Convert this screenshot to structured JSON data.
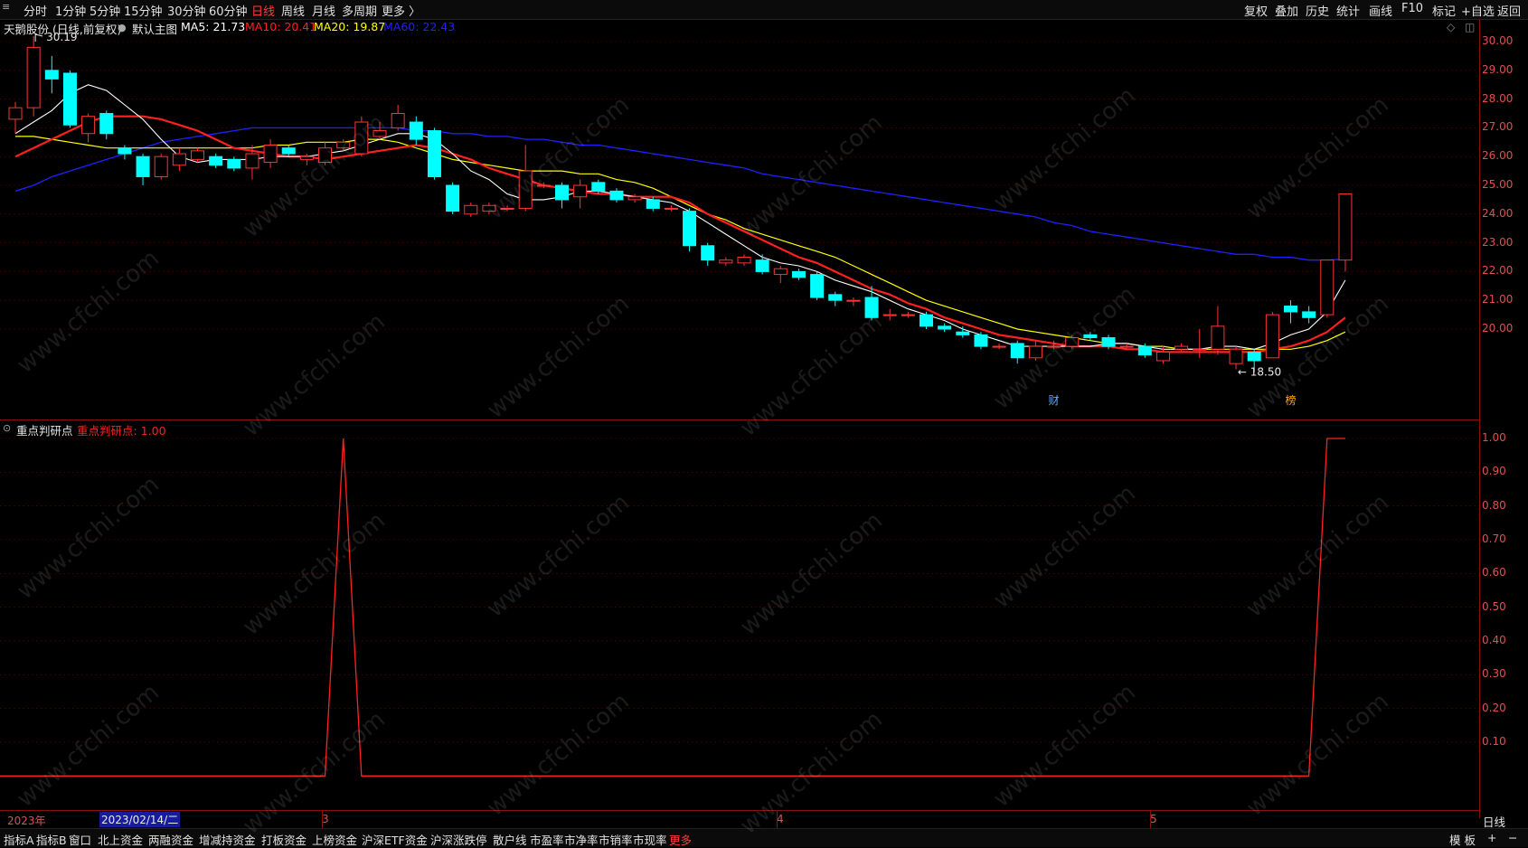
{
  "toolbar": {
    "left": [
      "分时",
      "1分钟",
      "5分钟",
      "15分钟",
      "30分钟",
      "60分钟",
      "日线",
      "周线",
      "月线",
      "多周期",
      "更多 〉"
    ],
    "active": "日线",
    "right": [
      "复权",
      "叠加",
      "历史",
      "统计",
      "画线",
      "F10",
      "标记",
      "+自选",
      "返回"
    ]
  },
  "main_info": {
    "stock": "天鹅股份 (日线,前复权)",
    "template": "默认主图",
    "ma5": "MA5: 21.73",
    "ma10": "MA10: 20.41",
    "ma20": "MA20: 19.87",
    "ma60": "MA60: 22.43",
    "high_label": "30.19",
    "low_label": "18.50",
    "marker_cai": "财",
    "marker_bang": "榜"
  },
  "sub_info": {
    "name": "重点判研点",
    "value": "重点判研点: 1.00"
  },
  "x_axis": {
    "year_label": "2023年",
    "cursor_date": "2023/02/14/二",
    "month_labels": [
      "3",
      "4",
      "5"
    ],
    "right_label": "日线"
  },
  "bottom_tabs": [
    "指标A",
    "指标B",
    "窗口",
    "北上资金",
    "两融资金",
    "增减持资金",
    "打板资金",
    "上榜资金",
    "沪深ETF资金",
    "沪深涨跌停",
    "散户线",
    "市盈率",
    "市净率",
    "市销率",
    "市现率",
    "更多"
  ],
  "bottom_active": "更多",
  "bottom_right": [
    "模 板",
    "+",
    "−"
  ],
  "watermark": "www.cfchi.com",
  "colors": {
    "up": "#ff3333",
    "down": "#00ffff",
    "ma5": "#ffffff",
    "ma10": "#ff2020",
    "ma20": "#ffff00",
    "ma60": "#2020ff",
    "axis": "#e05050",
    "grid": "#5a0000"
  },
  "chart_data": [
    {
      "type": "candlestick",
      "title": "天鹅股份 (日线,前复权)",
      "y_ticks": [
        30.0,
        29.0,
        28.0,
        27.0,
        26.0,
        25.0,
        24.0,
        23.0,
        22.0,
        21.0,
        20.0
      ],
      "ylim": [
        18.0,
        30.5
      ],
      "candles": [
        [
          27.3,
          27.7,
          27.9,
          26.8
        ],
        [
          27.7,
          29.8,
          30.19,
          27.4
        ],
        [
          29.0,
          28.7,
          29.5,
          28.2
        ],
        [
          28.9,
          27.1,
          29.0,
          27.0
        ],
        [
          26.8,
          27.4,
          27.5,
          26.5
        ],
        [
          27.5,
          26.8,
          27.6,
          26.6
        ],
        [
          26.3,
          26.1,
          26.4,
          25.9
        ],
        [
          26.0,
          25.3,
          26.1,
          25.0
        ],
        [
          25.3,
          26.0,
          26.1,
          25.2
        ],
        [
          25.7,
          26.1,
          26.3,
          25.5
        ],
        [
          25.9,
          26.2,
          26.3,
          25.8
        ],
        [
          26.0,
          25.7,
          26.1,
          25.6
        ],
        [
          25.9,
          25.6,
          26.0,
          25.5
        ],
        [
          25.6,
          26.1,
          26.4,
          25.2
        ],
        [
          25.8,
          26.4,
          26.6,
          25.6
        ],
        [
          26.3,
          26.1,
          26.4,
          26.0
        ],
        [
          25.9,
          26.0,
          26.1,
          25.7
        ],
        [
          25.8,
          26.3,
          26.5,
          25.7
        ],
        [
          26.3,
          26.5,
          26.6,
          26.2
        ],
        [
          26.1,
          27.2,
          27.4,
          26.0
        ],
        [
          26.7,
          26.9,
          27.2,
          26.6
        ],
        [
          27.0,
          27.5,
          27.8,
          26.9
        ],
        [
          27.2,
          26.6,
          27.4,
          26.4
        ],
        [
          26.9,
          25.3,
          27.0,
          25.2
        ],
        [
          25.0,
          24.1,
          25.1,
          24.0
        ],
        [
          24.0,
          24.3,
          24.4,
          23.9
        ],
        [
          24.1,
          24.3,
          24.4,
          24.0
        ],
        [
          24.2,
          24.2,
          24.3,
          24.1
        ],
        [
          24.2,
          25.5,
          26.4,
          24.1
        ],
        [
          25.0,
          25.0,
          25.1,
          24.9
        ],
        [
          25.0,
          24.5,
          25.1,
          24.2
        ],
        [
          24.6,
          25.0,
          25.2,
          24.2
        ],
        [
          25.1,
          24.8,
          25.2,
          24.7
        ],
        [
          24.8,
          24.5,
          24.9,
          24.4
        ],
        [
          24.5,
          24.6,
          24.7,
          24.4
        ],
        [
          24.5,
          24.2,
          24.6,
          24.1
        ],
        [
          24.2,
          24.2,
          24.3,
          24.1
        ],
        [
          24.1,
          22.9,
          24.2,
          22.7
        ],
        [
          22.9,
          22.4,
          23.0,
          22.2
        ],
        [
          22.3,
          22.4,
          22.5,
          22.2
        ],
        [
          22.3,
          22.5,
          22.6,
          22.2
        ],
        [
          22.4,
          22.0,
          22.6,
          21.9
        ],
        [
          21.9,
          22.1,
          22.2,
          21.6
        ],
        [
          22.0,
          21.8,
          22.1,
          21.7
        ],
        [
          21.9,
          21.1,
          22.0,
          21.0
        ],
        [
          21.2,
          21.0,
          21.3,
          20.8
        ],
        [
          21.0,
          21.0,
          21.1,
          20.8
        ],
        [
          21.1,
          20.4,
          21.5,
          20.3
        ],
        [
          20.5,
          20.5,
          20.7,
          20.3
        ],
        [
          20.5,
          20.5,
          20.6,
          20.4
        ],
        [
          20.5,
          20.1,
          20.6,
          20.0
        ],
        [
          20.1,
          20.0,
          20.2,
          19.9
        ],
        [
          19.9,
          19.8,
          20.1,
          19.7
        ],
        [
          19.8,
          19.4,
          19.9,
          19.3
        ],
        [
          19.4,
          19.4,
          19.5,
          19.3
        ],
        [
          19.5,
          19.0,
          19.6,
          18.8
        ],
        [
          19.0,
          19.4,
          19.6,
          18.9
        ],
        [
          19.4,
          19.4,
          19.6,
          19.3
        ],
        [
          19.4,
          19.7,
          19.8,
          19.3
        ],
        [
          19.8,
          19.7,
          19.9,
          19.6
        ],
        [
          19.7,
          19.4,
          19.8,
          19.3
        ],
        [
          19.4,
          19.4,
          19.5,
          19.3
        ],
        [
          19.4,
          19.1,
          19.5,
          19.0
        ],
        [
          18.9,
          19.2,
          19.4,
          18.8
        ],
        [
          19.3,
          19.4,
          19.5,
          19.2
        ],
        [
          19.3,
          19.3,
          20.0,
          19.0
        ],
        [
          19.3,
          20.1,
          20.8,
          19.1
        ],
        [
          18.8,
          19.3,
          19.4,
          18.6
        ],
        [
          19.2,
          18.9,
          19.3,
          18.5
        ],
        [
          19.0,
          20.5,
          20.6,
          19.0
        ],
        [
          20.8,
          20.6,
          21.0,
          20.2
        ],
        [
          20.6,
          20.4,
          20.8,
          20.2
        ],
        [
          20.5,
          22.4,
          22.4,
          20.4
        ],
        [
          22.4,
          24.7,
          24.7,
          22.0
        ]
      ],
      "ma5": [
        26.8,
        27.2,
        27.6,
        28.2,
        28.5,
        28.3,
        27.8,
        27.3,
        26.6,
        26.0,
        25.8,
        25.9,
        25.9,
        25.9,
        26.0,
        26.0,
        26.0,
        26.1,
        26.2,
        26.4,
        26.6,
        26.8,
        26.8,
        26.6,
        26.1,
        25.5,
        25.2,
        24.7,
        24.5,
        24.5,
        24.6,
        24.8,
        24.8,
        24.7,
        24.6,
        24.5,
        24.4,
        24.1,
        23.7,
        23.3,
        22.9,
        22.5,
        22.3,
        22.2,
        22.0,
        21.7,
        21.5,
        21.3,
        21.0,
        20.7,
        20.5,
        20.3,
        20.0,
        19.8,
        19.6,
        19.4,
        19.4,
        19.4,
        19.4,
        19.4,
        19.5,
        19.5,
        19.4,
        19.3,
        19.3,
        19.3,
        19.4,
        19.4,
        19.3,
        19.5,
        19.8,
        20.0,
        20.6,
        21.7
      ],
      "ma10": [
        26.0,
        26.3,
        26.6,
        26.9,
        27.2,
        27.4,
        27.4,
        27.4,
        27.3,
        27.1,
        26.9,
        26.6,
        26.3,
        26.2,
        26.1,
        26.0,
        26.0,
        25.9,
        26.0,
        26.1,
        26.2,
        26.3,
        26.4,
        26.3,
        26.1,
        25.9,
        25.6,
        25.4,
        25.2,
        25.0,
        24.9,
        24.8,
        24.7,
        24.7,
        24.6,
        24.6,
        24.6,
        24.4,
        24.0,
        23.7,
        23.4,
        23.1,
        22.8,
        22.5,
        22.3,
        22.0,
        21.7,
        21.4,
        21.2,
        20.9,
        20.7,
        20.4,
        20.2,
        20.0,
        19.8,
        19.7,
        19.6,
        19.5,
        19.4,
        19.4,
        19.4,
        19.3,
        19.3,
        19.2,
        19.2,
        19.2,
        19.2,
        19.2,
        19.2,
        19.3,
        19.4,
        19.6,
        19.9,
        20.4
      ],
      "ma20": [
        26.7,
        26.7,
        26.6,
        26.5,
        26.4,
        26.3,
        26.3,
        26.3,
        26.3,
        26.3,
        26.3,
        26.3,
        26.3,
        26.3,
        26.4,
        26.4,
        26.5,
        26.5,
        26.5,
        26.6,
        26.6,
        26.5,
        26.3,
        26.1,
        25.9,
        25.8,
        25.7,
        25.6,
        25.5,
        25.5,
        25.5,
        25.4,
        25.4,
        25.2,
        25.1,
        24.9,
        24.6,
        24.3,
        24.0,
        23.8,
        23.5,
        23.3,
        23.1,
        22.9,
        22.7,
        22.5,
        22.2,
        21.9,
        21.6,
        21.3,
        21.0,
        20.8,
        20.6,
        20.4,
        20.2,
        20.0,
        19.9,
        19.8,
        19.7,
        19.6,
        19.5,
        19.5,
        19.4,
        19.4,
        19.3,
        19.3,
        19.3,
        19.3,
        19.3,
        19.3,
        19.3,
        19.4,
        19.6,
        19.9
      ],
      "ma60": [
        24.8,
        25.0,
        25.3,
        25.5,
        25.7,
        25.9,
        26.1,
        26.3,
        26.5,
        26.6,
        26.7,
        26.8,
        26.9,
        27.0,
        27.0,
        27.0,
        27.0,
        27.0,
        27.0,
        27.0,
        27.0,
        27.0,
        26.9,
        26.9,
        26.8,
        26.8,
        26.7,
        26.7,
        26.6,
        26.6,
        26.5,
        26.4,
        26.4,
        26.3,
        26.2,
        26.1,
        26.0,
        25.9,
        25.8,
        25.7,
        25.6,
        25.4,
        25.3,
        25.2,
        25.1,
        25.0,
        24.9,
        24.8,
        24.7,
        24.6,
        24.5,
        24.4,
        24.3,
        24.2,
        24.1,
        24.0,
        23.9,
        23.7,
        23.6,
        23.4,
        23.3,
        23.2,
        23.1,
        23.0,
        22.9,
        22.8,
        22.7,
        22.6,
        22.6,
        22.5,
        22.5,
        22.4,
        22.4,
        22.43
      ]
    },
    {
      "type": "line",
      "title": "重点判研点",
      "y_ticks": [
        1.0,
        0.9,
        0.8,
        0.7,
        0.6,
        0.5,
        0.4,
        0.3,
        0.2,
        0.1
      ],
      "ylim": [
        0,
        1.0
      ],
      "values": [
        0,
        0,
        0,
        0,
        0,
        0,
        0,
        0,
        0,
        0,
        0,
        0,
        0,
        0,
        0,
        0,
        0,
        0,
        1,
        0,
        0,
        0,
        0,
        0,
        0,
        0,
        0,
        0,
        0,
        0,
        0,
        0,
        0,
        0,
        0,
        0,
        0,
        0,
        0,
        0,
        0,
        0,
        0,
        0,
        0,
        0,
        0,
        0,
        0,
        0,
        0,
        0,
        0,
        0,
        0,
        0,
        0,
        0,
        0,
        0,
        0,
        0,
        0,
        0,
        0,
        0,
        0,
        0,
        0,
        0,
        0,
        0,
        1,
        1
      ]
    }
  ]
}
